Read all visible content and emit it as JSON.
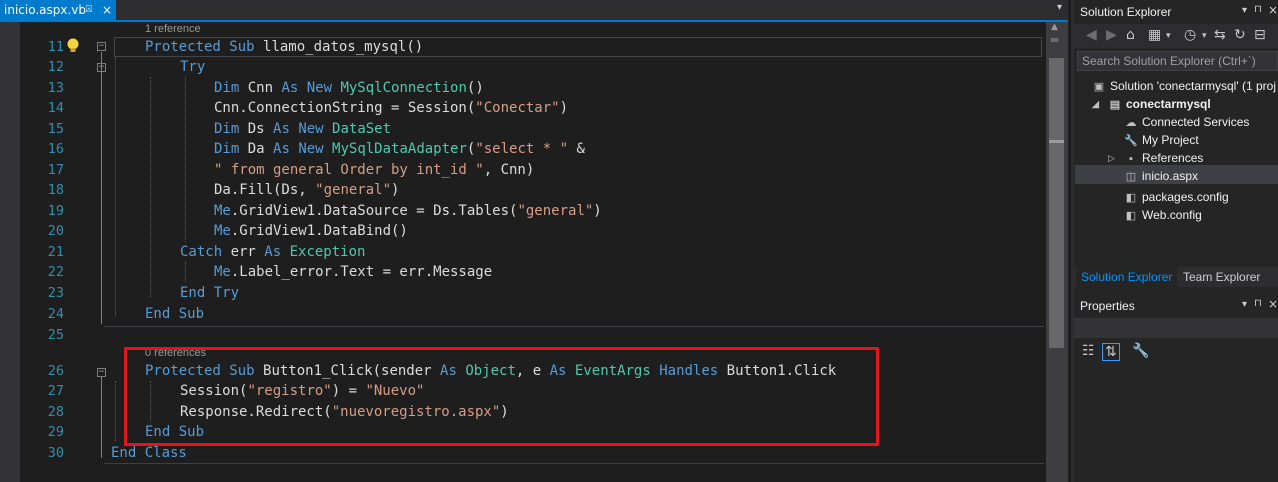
{
  "tab": {
    "label": "inicio.aspx.vb",
    "pin": "⍓",
    "close": "×"
  },
  "code_lens": {
    "method1_refs": "1 reference",
    "method2_refs": "0 references"
  },
  "lines": [
    {
      "n": "11",
      "tokens": [
        {
          "c": "kw",
          "t": "Protected Sub "
        },
        {
          "c": "",
          "t": "llamo_datos_mysql"
        },
        {
          "c": "",
          "t": "()"
        }
      ]
    },
    {
      "n": "12",
      "tokens": [
        {
          "c": "kw",
          "t": "Try"
        }
      ]
    },
    {
      "n": "13",
      "tokens": [
        {
          "c": "kw",
          "t": "Dim "
        },
        {
          "c": "",
          "t": "Cnn "
        },
        {
          "c": "kw",
          "t": "As "
        },
        {
          "c": "kw",
          "t": "New "
        },
        {
          "c": "ty",
          "t": "MySqlConnection"
        },
        {
          "c": "",
          "t": "()"
        }
      ]
    },
    {
      "n": "14",
      "tokens": [
        {
          "c": "",
          "t": "Cnn.ConnectionString = Session("
        },
        {
          "c": "st",
          "t": "\"Conectar\""
        },
        {
          "c": "",
          "t": ")"
        }
      ]
    },
    {
      "n": "15",
      "tokens": [
        {
          "c": "kw",
          "t": "Dim "
        },
        {
          "c": "",
          "t": "Ds "
        },
        {
          "c": "kw",
          "t": "As "
        },
        {
          "c": "kw",
          "t": "New "
        },
        {
          "c": "ty",
          "t": "DataSet"
        }
      ]
    },
    {
      "n": "16",
      "tokens": [
        {
          "c": "kw",
          "t": "Dim "
        },
        {
          "c": "",
          "t": "Da "
        },
        {
          "c": "kw",
          "t": "As "
        },
        {
          "c": "kw",
          "t": "New "
        },
        {
          "c": "ty",
          "t": "MySqlDataAdapter"
        },
        {
          "c": "",
          "t": "("
        },
        {
          "c": "st",
          "t": "\"select * \""
        },
        {
          "c": "",
          "t": " &"
        }
      ]
    },
    {
      "n": "17",
      "tokens": [
        {
          "c": "st",
          "t": "\" from general Order by int_id \""
        },
        {
          "c": "",
          "t": ", Cnn)"
        }
      ]
    },
    {
      "n": "18",
      "tokens": [
        {
          "c": "",
          "t": "Da.Fill(Ds, "
        },
        {
          "c": "st",
          "t": "\"general\""
        },
        {
          "c": "",
          "t": ")"
        }
      ]
    },
    {
      "n": "19",
      "tokens": [
        {
          "c": "kw",
          "t": "Me"
        },
        {
          "c": "",
          "t": ".GridView1.DataSource = Ds.Tables("
        },
        {
          "c": "st",
          "t": "\"general\""
        },
        {
          "c": "",
          "t": ")"
        }
      ]
    },
    {
      "n": "20",
      "tokens": [
        {
          "c": "kw",
          "t": "Me"
        },
        {
          "c": "",
          "t": ".GridView1.DataBind()"
        }
      ]
    },
    {
      "n": "21",
      "tokens": [
        {
          "c": "kw",
          "t": "Catch "
        },
        {
          "c": "",
          "t": "err "
        },
        {
          "c": "kw",
          "t": "As "
        },
        {
          "c": "ty",
          "t": "Exception"
        }
      ]
    },
    {
      "n": "22",
      "tokens": [
        {
          "c": "kw",
          "t": "Me"
        },
        {
          "c": "",
          "t": ".Label_error.Text = err.Message"
        }
      ]
    },
    {
      "n": "23",
      "tokens": [
        {
          "c": "kw",
          "t": "End Try"
        }
      ]
    },
    {
      "n": "24",
      "tokens": [
        {
          "c": "kw",
          "t": "End Sub"
        }
      ]
    },
    {
      "n": "25",
      "tokens": []
    },
    {
      "n": "26",
      "tokens": [
        {
          "c": "kw",
          "t": "Protected Sub "
        },
        {
          "c": "",
          "t": "Button1_Click(sender "
        },
        {
          "c": "kw",
          "t": "As "
        },
        {
          "c": "ty",
          "t": "Object"
        },
        {
          "c": "",
          "t": ", e "
        },
        {
          "c": "kw",
          "t": "As "
        },
        {
          "c": "ty",
          "t": "EventArgs"
        },
        {
          "c": "",
          "t": " "
        },
        {
          "c": "kw",
          "t": "Handles "
        },
        {
          "c": "",
          "t": "Button1.Click"
        }
      ]
    },
    {
      "n": "27",
      "tokens": [
        {
          "c": "",
          "t": "Session("
        },
        {
          "c": "st",
          "t": "\"registro\""
        },
        {
          "c": "",
          "t": ") = "
        },
        {
          "c": "st",
          "t": "\"Nuevo\""
        }
      ]
    },
    {
      "n": "28",
      "tokens": [
        {
          "c": "",
          "t": "Response.Redirect("
        },
        {
          "c": "st",
          "t": "\"nuevoregistro.aspx\""
        },
        {
          "c": "",
          "t": ")"
        }
      ]
    },
    {
      "n": "29",
      "tokens": [
        {
          "c": "kw",
          "t": "End Sub"
        }
      ]
    },
    {
      "n": "30",
      "tokens": [
        {
          "c": "kw",
          "t": "End Class"
        }
      ]
    }
  ],
  "solution_explorer": {
    "title": "Solution Explorer",
    "search_placeholder": "Search Solution Explorer (Ctrl+`)",
    "tree": [
      {
        "label": "Solution 'conectarmysql' (1 proj",
        "icon": "solution-icon",
        "bold": false
      },
      {
        "label": "conectarmysql",
        "icon": "project-icon",
        "bold": true
      },
      {
        "label": "Connected Services",
        "icon": "cloud-icon",
        "bold": false
      },
      {
        "label": "My Project",
        "icon": "wrench-icon",
        "bold": false
      },
      {
        "label": "References",
        "icon": "references-icon",
        "bold": false
      },
      {
        "label": "inicio.aspx",
        "icon": "aspx-file-icon",
        "bold": false
      },
      {
        "label": "packages.config",
        "icon": "config-file-icon",
        "bold": false
      },
      {
        "label": "Web.config",
        "icon": "config-file-icon",
        "bold": false
      }
    ],
    "tabs": [
      "Solution Explorer",
      "Team Explorer"
    ]
  },
  "properties": {
    "title": "Properties"
  },
  "colors": {
    "accent": "#007acc",
    "highlight_box": "#e3151a",
    "keyword": "#569cd6",
    "type": "#4ec9b0",
    "string": "#d69d85",
    "line_number": "#2b91af"
  }
}
